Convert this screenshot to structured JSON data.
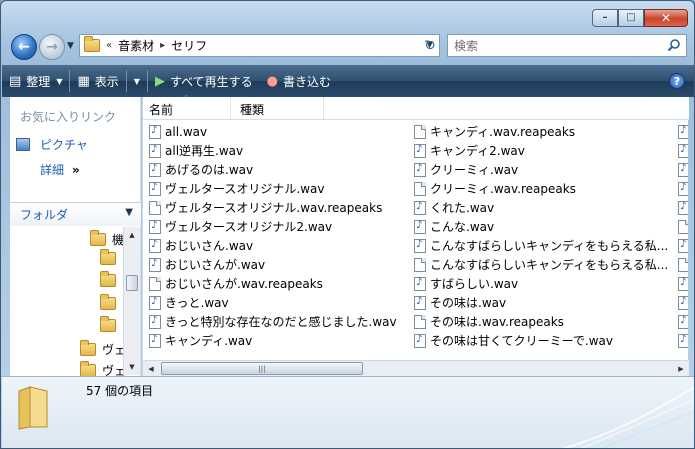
{
  "window": {
    "caption_buttons": {
      "minimize": "–",
      "maximize": "□",
      "close": "✕"
    }
  },
  "address": {
    "overflow_marker": "«",
    "crumbs": [
      "音素材",
      "セリフ"
    ]
  },
  "search": {
    "placeholder": "検索"
  },
  "toolbar": {
    "organize": "整理",
    "views": "表示",
    "play_all": "すべて再生する",
    "burn": "書き込む",
    "help": "?"
  },
  "left_pane": {
    "favorites_title": "お気に入りリンク",
    "favorites": [
      {
        "label": "ピクチャ"
      }
    ],
    "more_label": "詳細",
    "more_arrows": "»",
    "folders_label": "フォルダ",
    "tree": [
      {
        "label": "機"
      },
      {
        "label": ""
      },
      {
        "label": ""
      },
      {
        "label": ""
      },
      {
        "label": ""
      },
      {
        "label": "ヴェ"
      },
      {
        "label": "ヴェ"
      }
    ]
  },
  "columns": {
    "name": "名前",
    "type": "種類"
  },
  "files_col1": [
    {
      "name": "all.wav",
      "icon": "audio-icon"
    },
    {
      "name": "all逆再生.wav",
      "icon": "audio-icon"
    },
    {
      "name": "あげるのは.wav",
      "icon": "audio-icon"
    },
    {
      "name": "ヴェルタースオリジナル.wav",
      "icon": "audio-icon"
    },
    {
      "name": "ヴェルタースオリジナル.wav.reapeaks",
      "icon": "document-icon"
    },
    {
      "name": "ヴェルタースオリジナル2.wav",
      "icon": "audio-icon"
    },
    {
      "name": "おじいさん.wav",
      "icon": "audio-icon"
    },
    {
      "name": "おじいさんが.wav",
      "icon": "audio-icon"
    },
    {
      "name": "おじいさんが.wav.reapeaks",
      "icon": "document-icon"
    },
    {
      "name": "きっと.wav",
      "icon": "audio-icon"
    },
    {
      "name": "きっと特別な存在なのだと感じました.wav",
      "icon": "audio-icon"
    },
    {
      "name": "キャンディ.wav",
      "icon": "audio-icon"
    }
  ],
  "files_col2": [
    {
      "name": "キャンディ.wav.reapeaks",
      "icon": "document-icon"
    },
    {
      "name": "キャンディ2.wav",
      "icon": "audio-icon"
    },
    {
      "name": "クリーミィ.wav",
      "icon": "audio-icon"
    },
    {
      "name": "クリーミィ.wav.reapeaks",
      "icon": "document-icon"
    },
    {
      "name": "くれた.wav",
      "icon": "audio-icon"
    },
    {
      "name": "こんな.wav",
      "icon": "audio-icon"
    },
    {
      "name": "こんなすばらしいキャンディをもらえる私...",
      "icon": "audio-icon"
    },
    {
      "name": "こんなすばらしいキャンディをもらえる私...",
      "icon": "document-icon"
    },
    {
      "name": "すばらしい.wav",
      "icon": "audio-icon"
    },
    {
      "name": "その味は.wav",
      "icon": "audio-icon"
    },
    {
      "name": "その味は.wav.reapeaks",
      "icon": "document-icon"
    },
    {
      "name": "その味は甘くてクリーミーで.wav",
      "icon": "audio-icon"
    }
  ],
  "files_col3_icons": [
    "audio-icon",
    "audio-icon",
    "audio-icon",
    "audio-icon",
    "audio-icon",
    "document-icon",
    "audio-icon",
    "document-icon",
    "audio-icon",
    "audio-icon",
    "audio-icon",
    "audio-icon"
  ],
  "status": {
    "item_count": "57 個の項目"
  },
  "colors": {
    "toolbar_bg": "#2f4f70",
    "link": "#1a5eb0",
    "close_button": "#c9452b"
  }
}
